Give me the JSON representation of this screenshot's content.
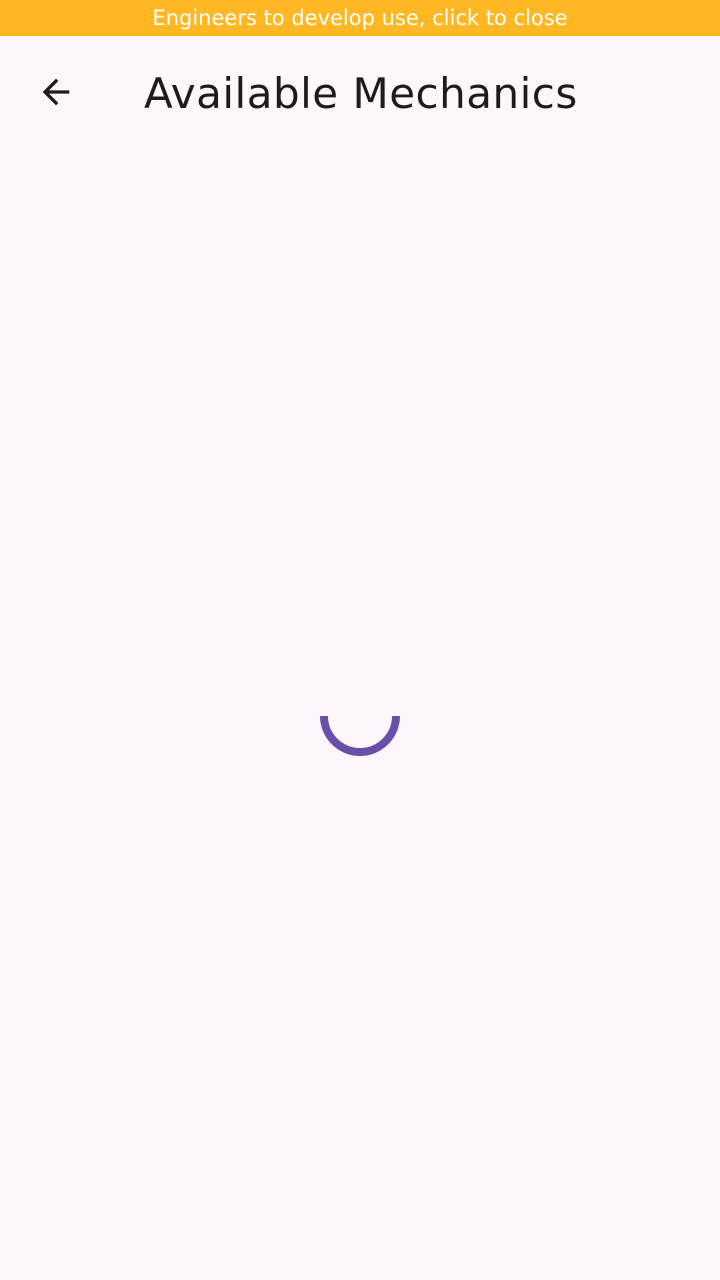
{
  "debug_banner": {
    "text": "Engineers to develop use, click to close",
    "color": "#ffb823"
  },
  "app_bar": {
    "title": "Available Mechanics",
    "back_icon": "arrow-back-icon"
  },
  "content": {
    "state": "loading",
    "spinner_color": "#6a4fa8",
    "spinner_icon": "circular-progress-icon"
  }
}
